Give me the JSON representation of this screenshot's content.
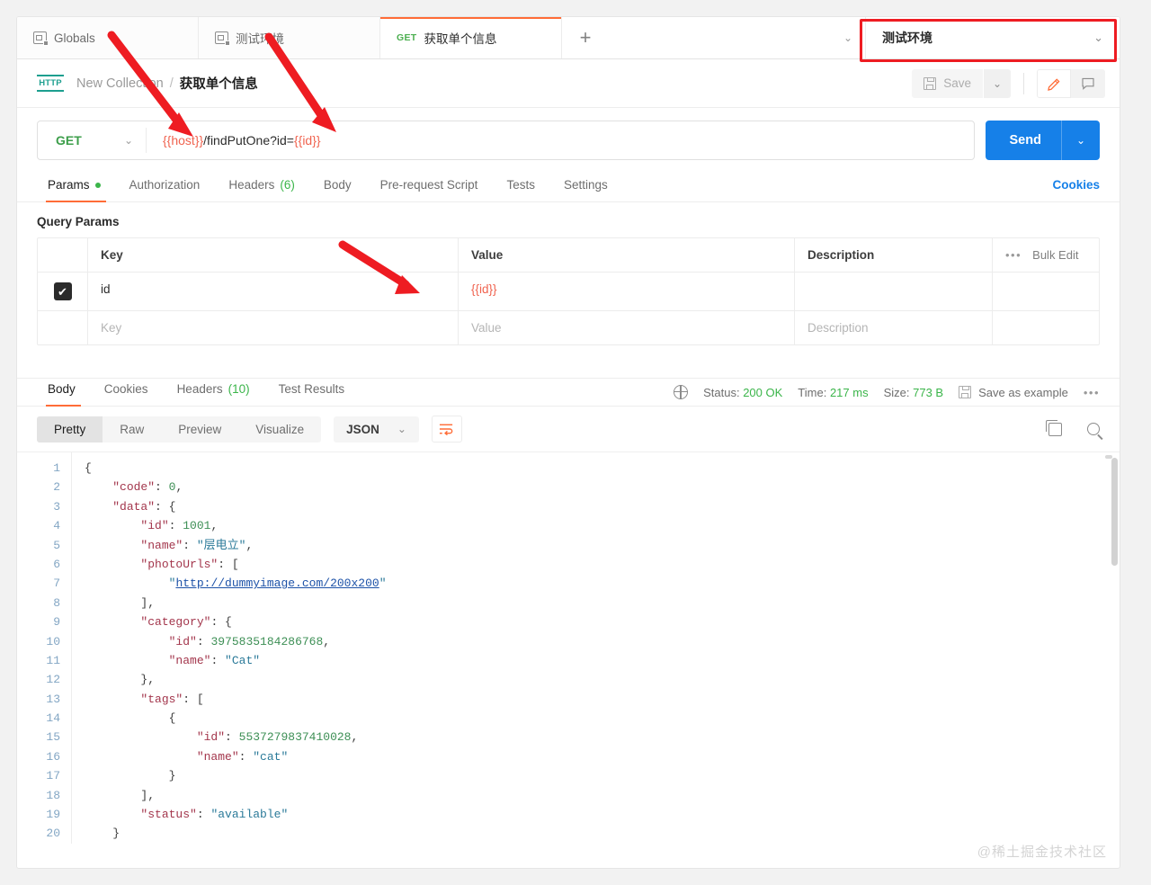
{
  "tabs": [
    {
      "label": "Globals",
      "icon": "environment-icon",
      "method": "",
      "active": false
    },
    {
      "label": "测试环境",
      "icon": "environment-icon",
      "method": "",
      "active": false
    },
    {
      "label": "获取单个信息",
      "icon": "",
      "method": "GET",
      "active": true
    }
  ],
  "tabbar": {
    "new_tab_label": "+",
    "overflow_chevron": "⌄",
    "environment": {
      "name": "测试环境",
      "chevron": "⌄"
    }
  },
  "request_header": {
    "protocol_badge": "HTTP",
    "breadcrumb_parent": "New Collection",
    "breadcrumb_separator": "/",
    "breadcrumb_current": "获取单个信息",
    "save_label": "Save",
    "save_caret": "⌄",
    "edit_icon": "pencil-icon",
    "comment_icon": "comment-icon"
  },
  "url_bar": {
    "method": "GET",
    "method_chevron": "⌄",
    "url_parts": [
      {
        "text": "{{host}}",
        "type": "variable"
      },
      {
        "text": "/findPutOne?id=",
        "type": "literal"
      },
      {
        "text": "{{id}}",
        "type": "variable"
      }
    ],
    "send_label": "Send",
    "send_chevron": "⌄"
  },
  "request_tabs": [
    {
      "label": "Params",
      "dot": true,
      "count": "",
      "active": true
    },
    {
      "label": "Authorization",
      "dot": false,
      "count": "",
      "active": false
    },
    {
      "label": "Headers",
      "dot": false,
      "count": "(6)",
      "active": false
    },
    {
      "label": "Body",
      "dot": false,
      "count": "",
      "active": false
    },
    {
      "label": "Pre-request Script",
      "dot": false,
      "count": "",
      "active": false
    },
    {
      "label": "Tests",
      "dot": false,
      "count": "",
      "active": false
    },
    {
      "label": "Settings",
      "dot": false,
      "count": "",
      "active": false
    }
  ],
  "cookies_link": "Cookies",
  "params": {
    "section_title": "Query Params",
    "columns": [
      "Key",
      "Value",
      "Description"
    ],
    "bulk_edit_label": "Bulk Edit",
    "bulk_edit_dots": "•••",
    "rows": [
      {
        "checked": true,
        "key": "id",
        "value": "{{id}}",
        "value_is_variable": true,
        "description": ""
      }
    ],
    "placeholder_row": {
      "key": "Key",
      "value": "Value",
      "description": "Description"
    }
  },
  "response": {
    "tabs": [
      {
        "label": "Body",
        "count": "",
        "active": true
      },
      {
        "label": "Cookies",
        "count": "",
        "active": false
      },
      {
        "label": "Headers",
        "count": "(10)",
        "active": false
      },
      {
        "label": "Test Results",
        "count": "",
        "active": false
      }
    ],
    "meta": {
      "globe_icon": "globe-icon",
      "status_label": "Status:",
      "status_value": "200 OK",
      "time_label": "Time:",
      "time_value": "217 ms",
      "size_label": "Size:",
      "size_value": "773 B",
      "save_example_label": "Save as example",
      "more_dots": "•••"
    },
    "viewer": {
      "modes": [
        "Pretty",
        "Raw",
        "Preview",
        "Visualize"
      ],
      "active_mode": "Pretty",
      "format": "JSON",
      "format_chevron": "⌄",
      "wrap_icon": "wrap-lines-icon",
      "copy_icon": "copy-icon",
      "search_icon": "search-icon"
    },
    "body_lines": [
      {
        "n": 1,
        "tokens": [
          {
            "t": "{",
            "c": "p"
          }
        ]
      },
      {
        "n": 2,
        "tokens": [
          {
            "t": "    ",
            "c": "p"
          },
          {
            "t": "\"code\"",
            "c": "k"
          },
          {
            "t": ": ",
            "c": "p"
          },
          {
            "t": "0",
            "c": "n"
          },
          {
            "t": ",",
            "c": "p"
          }
        ]
      },
      {
        "n": 3,
        "tokens": [
          {
            "t": "    ",
            "c": "p"
          },
          {
            "t": "\"data\"",
            "c": "k"
          },
          {
            "t": ": {",
            "c": "p"
          }
        ]
      },
      {
        "n": 4,
        "tokens": [
          {
            "t": "        ",
            "c": "p"
          },
          {
            "t": "\"id\"",
            "c": "k"
          },
          {
            "t": ": ",
            "c": "p"
          },
          {
            "t": "1001",
            "c": "n"
          },
          {
            "t": ",",
            "c": "p"
          }
        ]
      },
      {
        "n": 5,
        "tokens": [
          {
            "t": "        ",
            "c": "p"
          },
          {
            "t": "\"name\"",
            "c": "k"
          },
          {
            "t": ": ",
            "c": "p"
          },
          {
            "t": "\"层电立\"",
            "c": "s"
          },
          {
            "t": ",",
            "c": "p"
          }
        ]
      },
      {
        "n": 6,
        "tokens": [
          {
            "t": "        ",
            "c": "p"
          },
          {
            "t": "\"photoUrls\"",
            "c": "k"
          },
          {
            "t": ": [",
            "c": "p"
          }
        ]
      },
      {
        "n": 7,
        "tokens": [
          {
            "t": "            ",
            "c": "p"
          },
          {
            "t": "\"",
            "c": "s"
          },
          {
            "t": "http://dummyimage.com/200x200",
            "c": "u"
          },
          {
            "t": "\"",
            "c": "s"
          }
        ]
      },
      {
        "n": 8,
        "tokens": [
          {
            "t": "        ],",
            "c": "p"
          }
        ]
      },
      {
        "n": 9,
        "tokens": [
          {
            "t": "        ",
            "c": "p"
          },
          {
            "t": "\"category\"",
            "c": "k"
          },
          {
            "t": ": {",
            "c": "p"
          }
        ]
      },
      {
        "n": 10,
        "tokens": [
          {
            "t": "            ",
            "c": "p"
          },
          {
            "t": "\"id\"",
            "c": "k"
          },
          {
            "t": ": ",
            "c": "p"
          },
          {
            "t": "3975835184286768",
            "c": "n"
          },
          {
            "t": ",",
            "c": "p"
          }
        ]
      },
      {
        "n": 11,
        "tokens": [
          {
            "t": "            ",
            "c": "p"
          },
          {
            "t": "\"name\"",
            "c": "k"
          },
          {
            "t": ": ",
            "c": "p"
          },
          {
            "t": "\"Cat\"",
            "c": "s"
          }
        ]
      },
      {
        "n": 12,
        "tokens": [
          {
            "t": "        },",
            "c": "p"
          }
        ]
      },
      {
        "n": 13,
        "tokens": [
          {
            "t": "        ",
            "c": "p"
          },
          {
            "t": "\"tags\"",
            "c": "k"
          },
          {
            "t": ": [",
            "c": "p"
          }
        ]
      },
      {
        "n": 14,
        "tokens": [
          {
            "t": "            {",
            "c": "p"
          }
        ]
      },
      {
        "n": 15,
        "tokens": [
          {
            "t": "                ",
            "c": "p"
          },
          {
            "t": "\"id\"",
            "c": "k"
          },
          {
            "t": ": ",
            "c": "p"
          },
          {
            "t": "5537279837410028",
            "c": "n"
          },
          {
            "t": ",",
            "c": "p"
          }
        ]
      },
      {
        "n": 16,
        "tokens": [
          {
            "t": "                ",
            "c": "p"
          },
          {
            "t": "\"name\"",
            "c": "k"
          },
          {
            "t": ": ",
            "c": "p"
          },
          {
            "t": "\"cat\"",
            "c": "s"
          }
        ]
      },
      {
        "n": 17,
        "tokens": [
          {
            "t": "            }",
            "c": "p"
          }
        ]
      },
      {
        "n": 18,
        "tokens": [
          {
            "t": "        ],",
            "c": "p"
          }
        ]
      },
      {
        "n": 19,
        "tokens": [
          {
            "t": "        ",
            "c": "p"
          },
          {
            "t": "\"status\"",
            "c": "k"
          },
          {
            "t": ": ",
            "c": "p"
          },
          {
            "t": "\"available\"",
            "c": "s"
          }
        ]
      },
      {
        "n": 20,
        "tokens": [
          {
            "t": "    }",
            "c": "p"
          }
        ]
      }
    ]
  },
  "watermark": "@稀土掘金技术社区",
  "annotation_color": "#ee1c22"
}
